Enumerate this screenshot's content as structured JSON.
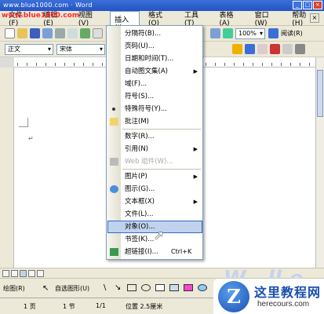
{
  "window": {
    "title": "www.blue1000.com · Word",
    "watermark_url": "www.blue1000.com",
    "minimize": "_",
    "maximize": "□",
    "close": "×"
  },
  "menubar": {
    "items": [
      {
        "label": "文件(F)",
        "active": false
      },
      {
        "label": "编辑(E)",
        "active": false
      },
      {
        "label": "视图(V)",
        "active": false
      },
      {
        "label": "插入(I)",
        "active": true
      },
      {
        "label": "格式(O)",
        "active": false
      },
      {
        "label": "工具(T)",
        "active": false
      },
      {
        "label": "表格(A)",
        "active": false
      },
      {
        "label": "窗口(W)",
        "active": false
      },
      {
        "label": "帮助(H)",
        "active": false
      }
    ],
    "close_doc": "×"
  },
  "toolbar": {
    "zoom": "100%",
    "read_label": "阅读(R)"
  },
  "format_toolbar": {
    "style": "正文",
    "font": "宋体"
  },
  "insert_menu": {
    "items": [
      {
        "label": "分隔符(B)...",
        "icon": "",
        "arrow": false,
        "disabled": false,
        "highlight": false
      },
      {
        "label": "页码(U)...",
        "icon": "",
        "arrow": false,
        "disabled": false,
        "highlight": false
      },
      {
        "label": "日期和时间(T)...",
        "icon": "",
        "arrow": false,
        "disabled": false,
        "highlight": false
      },
      {
        "label": "自动图文集(A)",
        "icon": "",
        "arrow": true,
        "disabled": false,
        "highlight": false
      },
      {
        "label": "域(F)...",
        "icon": "",
        "arrow": false,
        "disabled": false,
        "highlight": false
      },
      {
        "label": "符号(S)...",
        "icon": "",
        "arrow": false,
        "disabled": false,
        "highlight": false
      },
      {
        "label": "特殊符号(Y)...",
        "icon": "symbol-icon",
        "arrow": false,
        "disabled": false,
        "highlight": false
      },
      {
        "label": "批注(M)",
        "icon": "comment-icon",
        "arrow": false,
        "disabled": false,
        "highlight": false,
        "sep_after": true
      },
      {
        "label": "数字(R)...",
        "icon": "",
        "arrow": false,
        "disabled": false,
        "highlight": false
      },
      {
        "label": "引用(N)",
        "icon": "",
        "arrow": true,
        "disabled": false,
        "highlight": false
      },
      {
        "label": "Web 组件(W)...",
        "icon": "web-component-icon",
        "arrow": false,
        "disabled": true,
        "highlight": false,
        "sep_after": true
      },
      {
        "label": "图片(P)",
        "icon": "",
        "arrow": true,
        "disabled": false,
        "highlight": false
      },
      {
        "label": "图示(G)...",
        "icon": "diagram-icon",
        "arrow": false,
        "disabled": false,
        "highlight": false
      },
      {
        "label": "文本框(X)",
        "icon": "",
        "arrow": true,
        "disabled": false,
        "highlight": false
      },
      {
        "label": "文件(L)...",
        "icon": "",
        "arrow": false,
        "disabled": false,
        "highlight": false
      },
      {
        "label": "对象(O)...",
        "icon": "",
        "arrow": false,
        "disabled": false,
        "highlight": true
      },
      {
        "label": "书签(K)...",
        "icon": "",
        "arrow": false,
        "disabled": false,
        "highlight": false
      },
      {
        "label": "超链接(I)...",
        "icon": "hyperlink-icon",
        "shortcut": "Ctrl+K",
        "arrow": false,
        "disabled": false,
        "highlight": false
      }
    ]
  },
  "drawing": {
    "draw_label": "绘图(R)",
    "autoshape_label": "自选图形(U)"
  },
  "status": {
    "page": "1 页",
    "section": "1 节",
    "pages": "1/1",
    "position": "位置 2.5厘米"
  },
  "document": {
    "para_mark": "↵"
  },
  "logo": {
    "line1": "这里教程网",
    "line2": "herecours.com",
    "letter": "Z"
  },
  "word_watermark": "W...ll.e"
}
